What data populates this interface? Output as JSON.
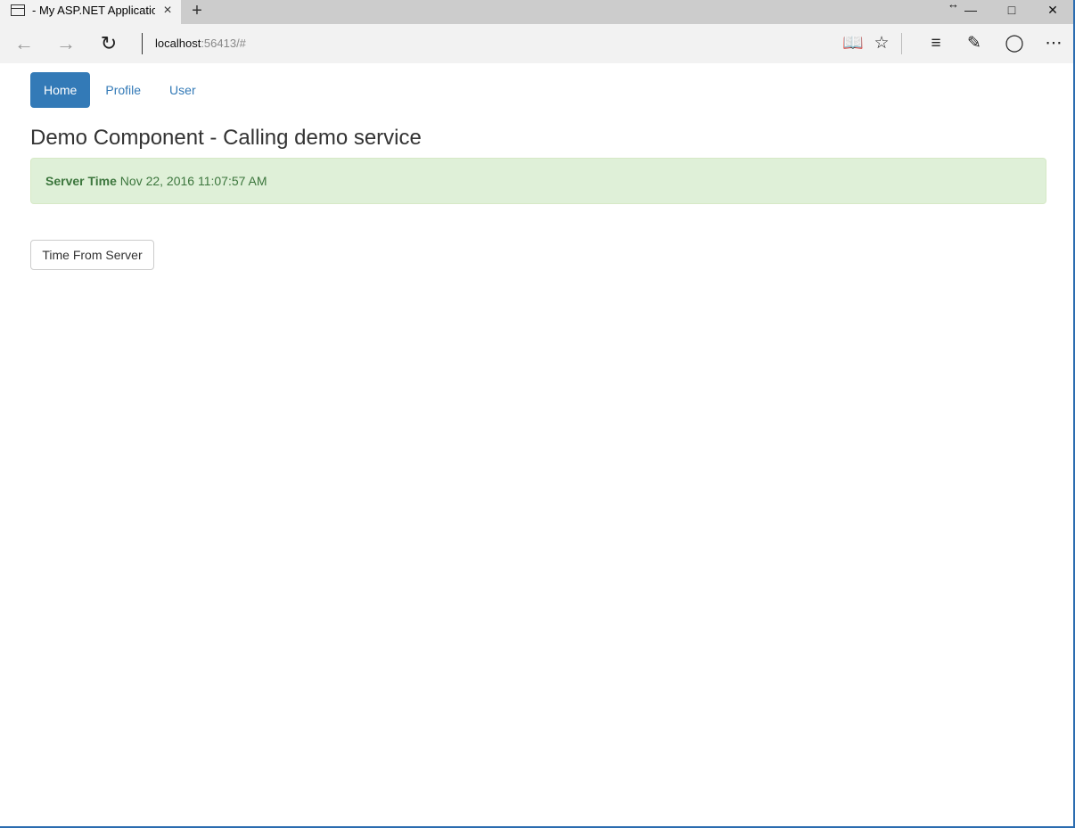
{
  "browser": {
    "tab_title": "- My ASP.NET Applicatio",
    "tab_close_icon": "×",
    "new_tab_icon": "+",
    "address_host": "localhost",
    "address_rest": ":56413/#",
    "icons": [
      "back-icon",
      "forward-icon",
      "refresh-icon",
      "reading-view-icon",
      "favorite-star-icon",
      "hub-icon",
      "web-note-icon",
      "share-icon",
      "more-icon"
    ]
  },
  "nav": {
    "items": [
      {
        "label": "Home",
        "active": true
      },
      {
        "label": "Profile",
        "active": false
      },
      {
        "label": "User",
        "active": false
      }
    ]
  },
  "main": {
    "title": "Demo Component - Calling demo service",
    "alert": {
      "label": "Server Time",
      "value": "Nov 22, 2016 11:07:57 AM"
    },
    "button_label": "Time From Server"
  },
  "colors": {
    "primary": "#337ab7",
    "success_bg": "#dff0d8",
    "success_text": "#3c763d"
  }
}
